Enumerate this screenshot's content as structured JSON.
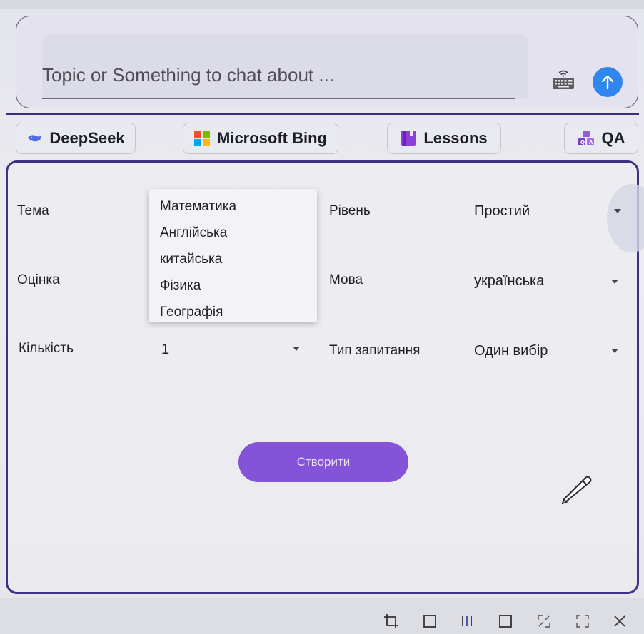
{
  "chat": {
    "placeholder": "Topic or Something to chat about ..."
  },
  "tabs": [
    {
      "label": "DeepSeek",
      "icon": "deepseek-whale-icon"
    },
    {
      "label": "Microsoft Bing",
      "icon": "microsoft-logo-icon"
    },
    {
      "label": "Lessons",
      "icon": "book-icon"
    },
    {
      "label": "QA",
      "icon": "qa-blocks-icon"
    }
  ],
  "form": {
    "topic_label": "Тема",
    "topic_options": [
      "Математика",
      "Англійська",
      "китайська",
      "Фізика",
      "Географія"
    ],
    "level_label": "Рівень",
    "level_value": "Простий",
    "grade_label": "Оцінка",
    "language_label": "Мова",
    "language_value": "українська",
    "count_label": "Кількість",
    "count_value": "1",
    "question_type_label": "Тип запитання",
    "question_type_value": "Один вибір",
    "create_label": "Створити"
  },
  "colors": {
    "accent_purple": "#8453d8",
    "panel_border": "#3e3282",
    "send_blue": "#2f86ee"
  },
  "bottom_toolbar_icons": [
    "crop-icon",
    "square-icon",
    "split-view-icon",
    "window-icon",
    "shrink-icon",
    "fullscreen-icon",
    "close-icon"
  ]
}
